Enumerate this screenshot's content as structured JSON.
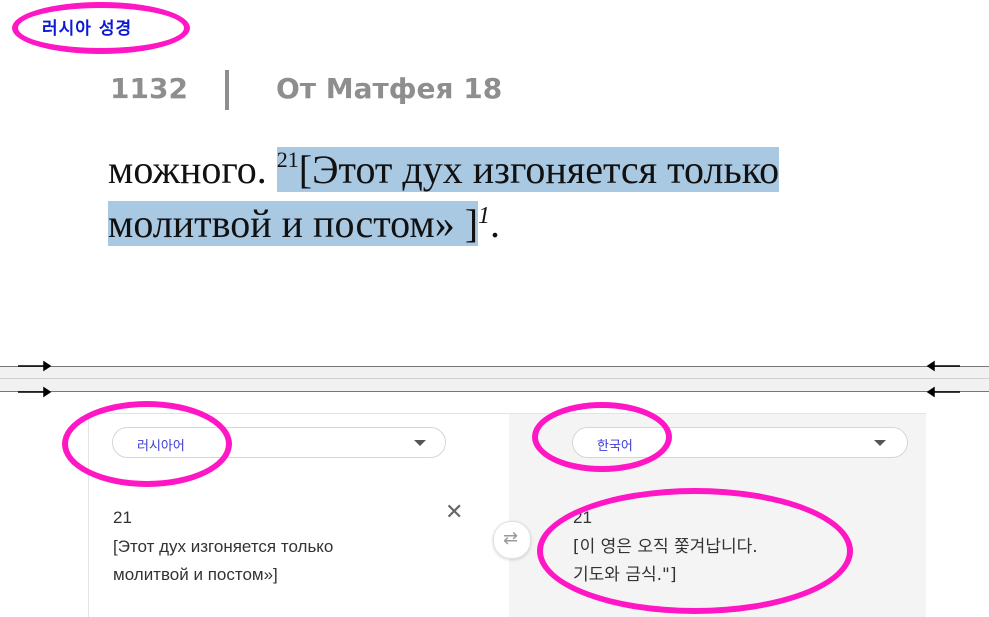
{
  "annotation": {
    "top_label": "러시아 성경"
  },
  "book": {
    "page_number": "1132",
    "chapter": "От Матфея 18",
    "verse_line_1_lead": "можного. ",
    "verse_number": "21",
    "verse_line_1_highlight": "[Этот дух изгоняется только",
    "verse_line_2_highlight": "молитвой и постом» ]",
    "footnote_marker": "1",
    "verse_line_2_tail": "."
  },
  "translator": {
    "source_language": "러시아어",
    "target_language": "한국어",
    "source_text": {
      "number": "21",
      "line1": "[Этот дух изгоняется только",
      "line2": "молитвой и постом»]"
    },
    "target_text": {
      "number": "21",
      "line1": "[이 영은 오직 쫓겨납니다.",
      "line2": "기도와 금식.\"]"
    },
    "clear_icon": "close-icon",
    "swap_icon": "swap-icon"
  },
  "colors": {
    "annotation_magenta": "#ff16c4",
    "annotation_text_blue": "#0b18d6",
    "highlight": "#a9c8e2"
  }
}
